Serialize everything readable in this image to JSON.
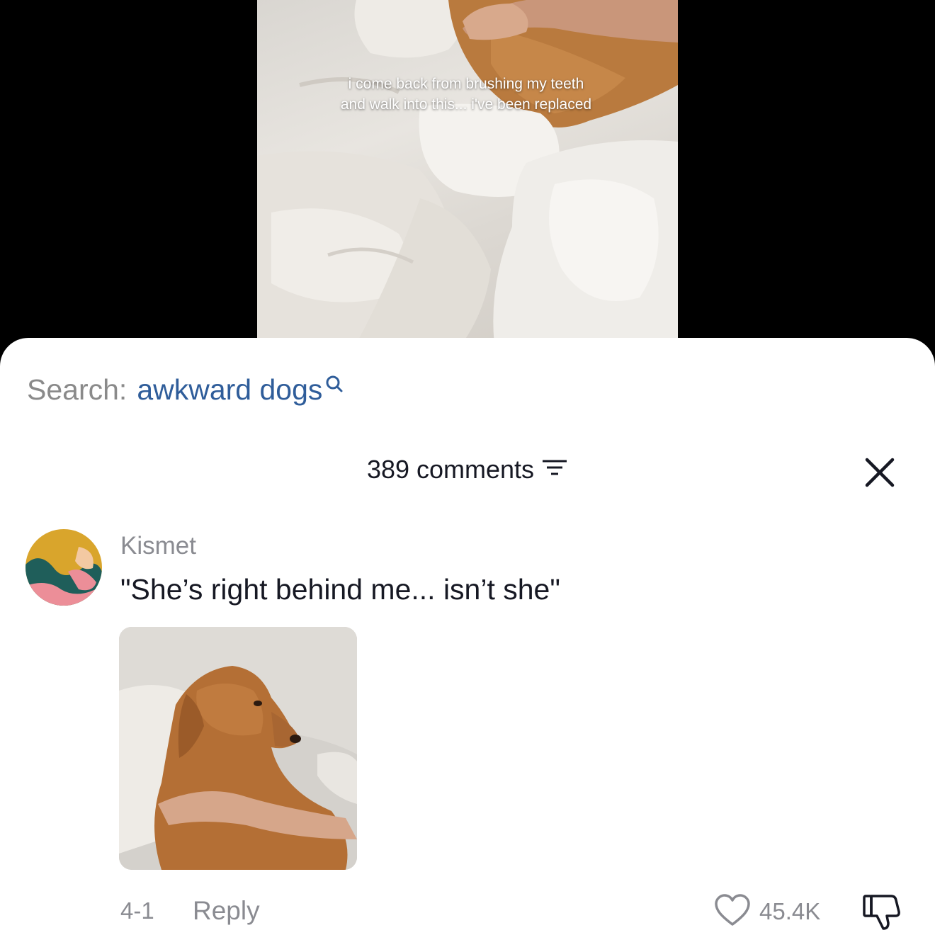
{
  "video": {
    "caption": "i come back from brushing my teeth and walk into this... i've been replaced"
  },
  "search": {
    "label": "Search:",
    "query": "awkward dogs",
    "icon": "search-icon"
  },
  "comments_header": {
    "count_text": "389 comments",
    "filter_icon": "filter-icon",
    "close_icon": "close-icon"
  },
  "comment": {
    "username": "Kismet",
    "text": "\"She’s right behind me... isn’t she\"",
    "date": "4-1",
    "reply_label": "Reply",
    "likes": "45.4K",
    "like_icon": "heart-icon",
    "dislike_icon": "thumbs-down-icon"
  },
  "colors": {
    "search_query": "#2f5d9a",
    "muted_text": "#8a8b91",
    "primary_text": "#161823"
  }
}
